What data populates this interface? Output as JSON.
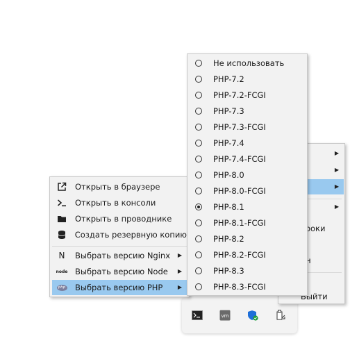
{
  "parent_menu": {
    "visible_texts": [
      "троки",
      "ён",
      "Выйти"
    ]
  },
  "context_menu": {
    "items": [
      {
        "label": "Открыть в браузере",
        "icon": "external-link-icon"
      },
      {
        "label": "Открыть в консоли",
        "icon": "terminal-prompt-icon"
      },
      {
        "label": "Открыть в проводнике",
        "icon": "folder-icon"
      },
      {
        "label": "Создать резервную копию",
        "icon": "database-icon"
      },
      {
        "label": "Выбрать версию Nginx",
        "icon": "nginx-icon",
        "icon_text": "N"
      },
      {
        "label": "Выбрать версию Node",
        "icon": "node-icon",
        "icon_text": "node"
      },
      {
        "label": "Выбрать версию PHP",
        "icon": "php-icon",
        "icon_text": "php",
        "active": true
      }
    ]
  },
  "php_menu": {
    "selected": "PHP-8.1",
    "options": [
      "Не использовать",
      "PHP-7.2",
      "PHP-7.2-FCGI",
      "PHP-7.3",
      "PHP-7.3-FCGI",
      "PHP-7.4",
      "PHP-7.4-FCGI",
      "PHP-8.0",
      "PHP-8.0-FCGI",
      "PHP-8.1",
      "PHP-8.1-FCGI",
      "PHP-8.2",
      "PHP-8.2-FCGI",
      "PHP-8.3",
      "PHP-8.3-FCGI"
    ]
  },
  "tray": {
    "icons": [
      "terminal-tray-icon",
      "vm-tray-icon",
      "security-shield-tray-icon",
      "usb-eject-tray-icon"
    ],
    "vm_text": "vm"
  },
  "colors": {
    "menu_bg": "#f2f2f2",
    "highlight": "#99c9ef",
    "border": "#c8c8c8"
  }
}
